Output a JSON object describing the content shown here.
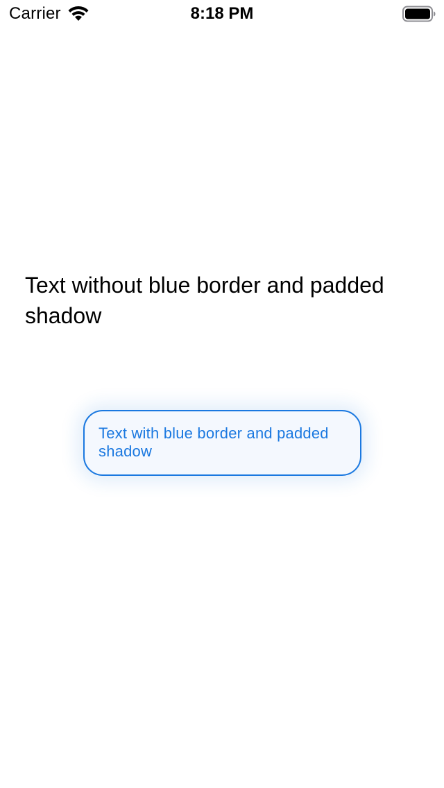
{
  "status_bar": {
    "carrier": "Carrier",
    "time": "8:18 PM",
    "wifi_icon": "wifi-icon",
    "battery_icon": "battery-icon"
  },
  "main": {
    "plain_text": "Text without blue border and padded shadow",
    "bordered_text": "Text with blue border and padded shadow"
  },
  "colors": {
    "accent": "#1a78e0",
    "background": "#ffffff",
    "text": "#000000"
  }
}
